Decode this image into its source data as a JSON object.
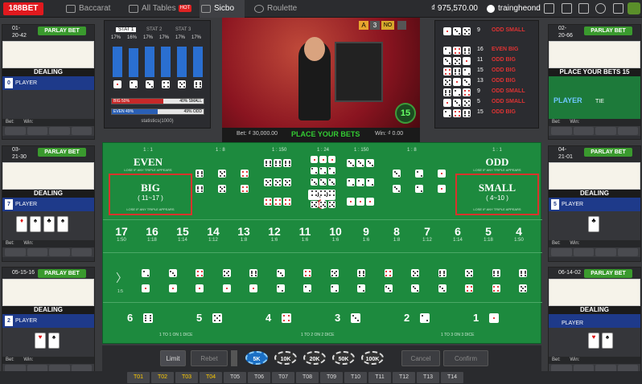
{
  "brand": {
    "logo": "188BET"
  },
  "nav": {
    "tabs": [
      {
        "label": "Baccarat"
      },
      {
        "label": "All Tables",
        "badge": "HOT"
      },
      {
        "label": "Sicbo"
      },
      {
        "label": "Roulette"
      }
    ]
  },
  "account": {
    "balance": "₫ 975,570.00",
    "username": "traingheond"
  },
  "left_tables": [
    {
      "date": "01-\n20-42",
      "parlay": "PARLAY BET",
      "status": "DEALING",
      "num": "0",
      "label": "PLAYER",
      "bet": "Bet:",
      "win": "Win:"
    },
    {
      "date": "03-\n21-30",
      "parlay": "PARLAY BET",
      "status": "DEALING",
      "num": "7",
      "label": "PLAYER",
      "bet": "Bet:",
      "win": "Win:"
    },
    {
      "date": "05-15-16",
      "parlay": "PARLAY BET",
      "status": "DEALING",
      "num": "2",
      "label": "PLAYER",
      "bet": "Bet:",
      "win": "Win:"
    }
  ],
  "right_tables": [
    {
      "date": "02-\n20-66",
      "parlay": "PARLAY BET",
      "status": "PLACE YOUR BETS",
      "timer": "15",
      "label": "PLAYER",
      "tie": "TIE",
      "bet": "Bet:",
      "win": "Win:"
    },
    {
      "date": "04-\n21-01",
      "parlay": "PARLAY BET",
      "status": "DEALING",
      "num": "5",
      "label": "PLAYER",
      "bet": "Bet:",
      "win": "Win:"
    },
    {
      "date": "06-14-02",
      "parlay": "PARLAY BET",
      "status": "DEALING",
      "label": "PLAYER",
      "bet": "Bet:",
      "win": "Win:"
    }
  ],
  "stats": {
    "tabs": [
      "STAT 1",
      "STAT 2",
      "STAT 3"
    ],
    "percents": [
      "17%",
      "16%",
      "17%",
      "17%",
      "17%",
      "17%"
    ],
    "bars": [
      0.9,
      0.85,
      0.9,
      0.9,
      0.9,
      0.9
    ],
    "big": "BIG 50%",
    "small": "40% SMALL",
    "even": "EVEN 49%",
    "odd": "49% ODD",
    "footer": "statistics(1000)"
  },
  "video": {
    "bet": "Bet: ₫ 30,000.00",
    "status": "PLACE YOUR BETS",
    "win": "Win: ₫ 0.00",
    "timer": "15",
    "round_a": "A",
    "round_n": "3",
    "no": "NO"
  },
  "results": {
    "top": {
      "sum": "9",
      "tags": "ODD SMALL"
    },
    "rows": [
      {
        "sum": "16",
        "tags": "EVEN BIG"
      },
      {
        "sum": "11",
        "tags": "ODD BIG"
      },
      {
        "sum": "15",
        "tags": "ODD BIG"
      },
      {
        "sum": "13",
        "tags": "ODD BIG"
      },
      {
        "sum": "9",
        "tags": "ODD SMALL"
      },
      {
        "sum": "5",
        "tags": "ODD SMALL"
      },
      {
        "sum": "15",
        "tags": "ODD BIG"
      }
    ]
  },
  "table": {
    "even": "EVEN",
    "odd": "ODD",
    "even_pay": "1 : 1",
    "odd_pay": "1 : 1",
    "lose_note": "LOSE IF ANY TRIPLE APPEARS",
    "big": "BIG",
    "big_range": "( 11~17 )",
    "small": "SMALL",
    "small_range": "( 4~10 )",
    "triple_pay": "1 : 150",
    "any_triple_pay": "1 : 24",
    "double_pay": "1 : 8",
    "chip_amount": "30,000",
    "totals": [
      {
        "n": "17",
        "p": "1:50"
      },
      {
        "n": "16",
        "p": "1:18"
      },
      {
        "n": "15",
        "p": "1:14"
      },
      {
        "n": "14",
        "p": "1:12"
      },
      {
        "n": "13",
        "p": "1:8"
      },
      {
        "n": "12",
        "p": "1:6"
      },
      {
        "n": "11",
        "p": "1:6"
      },
      {
        "n": "10",
        "p": "1:6"
      },
      {
        "n": "9",
        "p": "1:6"
      },
      {
        "n": "8",
        "p": "1:8"
      },
      {
        "n": "7",
        "p": "1:12"
      },
      {
        "n": "6",
        "p": "1:14"
      },
      {
        "n": "5",
        "p": "1:18"
      },
      {
        "n": "4",
        "p": "1:50"
      }
    ],
    "combo_pay": "1:5",
    "singles": [
      "6",
      "5",
      "4",
      "3",
      "2",
      "1"
    ],
    "single_notes": [
      "1 TO 1 ON 1 DICE",
      "1 TO 2 ON 2 DICE",
      "1 TO 3 ON 3 DICE"
    ]
  },
  "controls": {
    "limit": "Limit",
    "rebet": "Rebet",
    "cancel": "Cancel",
    "confirm": "Confirm",
    "chips": [
      "5K",
      "10K",
      "20K",
      "50K",
      "100K"
    ]
  },
  "table_tabs": [
    "T01",
    "T02",
    "T03",
    "T04",
    "T05",
    "T06",
    "T07",
    "T08",
    "T09",
    "T10",
    "T11",
    "T12",
    "T13",
    "T14"
  ]
}
